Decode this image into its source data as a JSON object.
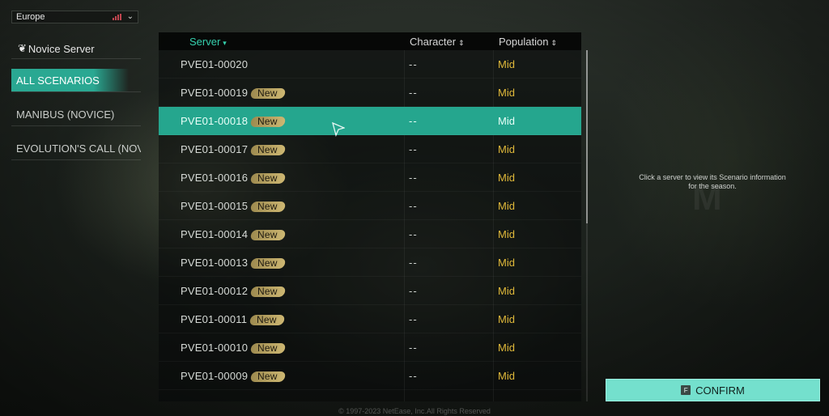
{
  "region": {
    "label": "Europe"
  },
  "sidebar": {
    "novice_label": "Novice Server",
    "scenarios": [
      {
        "label": "ALL SCENARIOS",
        "active": true
      },
      {
        "label": "MANIBUS (NOVICE)",
        "active": false
      },
      {
        "label": "EVOLUTION'S CALL (NOVI",
        "active": false
      }
    ]
  },
  "table": {
    "headers": {
      "server": "Server",
      "character": "Character",
      "population": "Population"
    },
    "rows": [
      {
        "name": "PVE01-00020",
        "badge": "",
        "character": "--",
        "population": "Mid"
      },
      {
        "name": "PVE01-00019",
        "badge": "New",
        "character": "--",
        "population": "Mid"
      },
      {
        "name": "PVE01-00018",
        "badge": "New",
        "character": "--",
        "population": "Mid"
      },
      {
        "name": "PVE01-00017",
        "badge": "New",
        "character": "--",
        "population": "Mid"
      },
      {
        "name": "PVE01-00016",
        "badge": "New",
        "character": "--",
        "population": "Mid"
      },
      {
        "name": "PVE01-00015",
        "badge": "New",
        "character": "--",
        "population": "Mid"
      },
      {
        "name": "PVE01-00014",
        "badge": "New",
        "character": "--",
        "population": "Mid"
      },
      {
        "name": "PVE01-00013",
        "badge": "New",
        "character": "--",
        "population": "Mid"
      },
      {
        "name": "PVE01-00012",
        "badge": "New",
        "character": "--",
        "population": "Mid"
      },
      {
        "name": "PVE01-00011",
        "badge": "New",
        "character": "--",
        "population": "Mid"
      },
      {
        "name": "PVE01-00010",
        "badge": "New",
        "character": "--",
        "population": "Mid"
      },
      {
        "name": "PVE01-00009",
        "badge": "New",
        "character": "--",
        "population": "Mid"
      }
    ],
    "selected_index": 2
  },
  "info": {
    "line1": "Click a server to view its Scenario information",
    "line2": "for the season."
  },
  "confirm": {
    "key": "F",
    "label": "CONFIRM"
  },
  "footer": {
    "copyright": "© 1997-2023 NetEase, Inc.All Rights Reserved"
  },
  "colors": {
    "accent": "#25a68e",
    "confirm_bg": "#74e0cd",
    "population_mid": "#e0b93a",
    "badge": "#cdb772"
  }
}
